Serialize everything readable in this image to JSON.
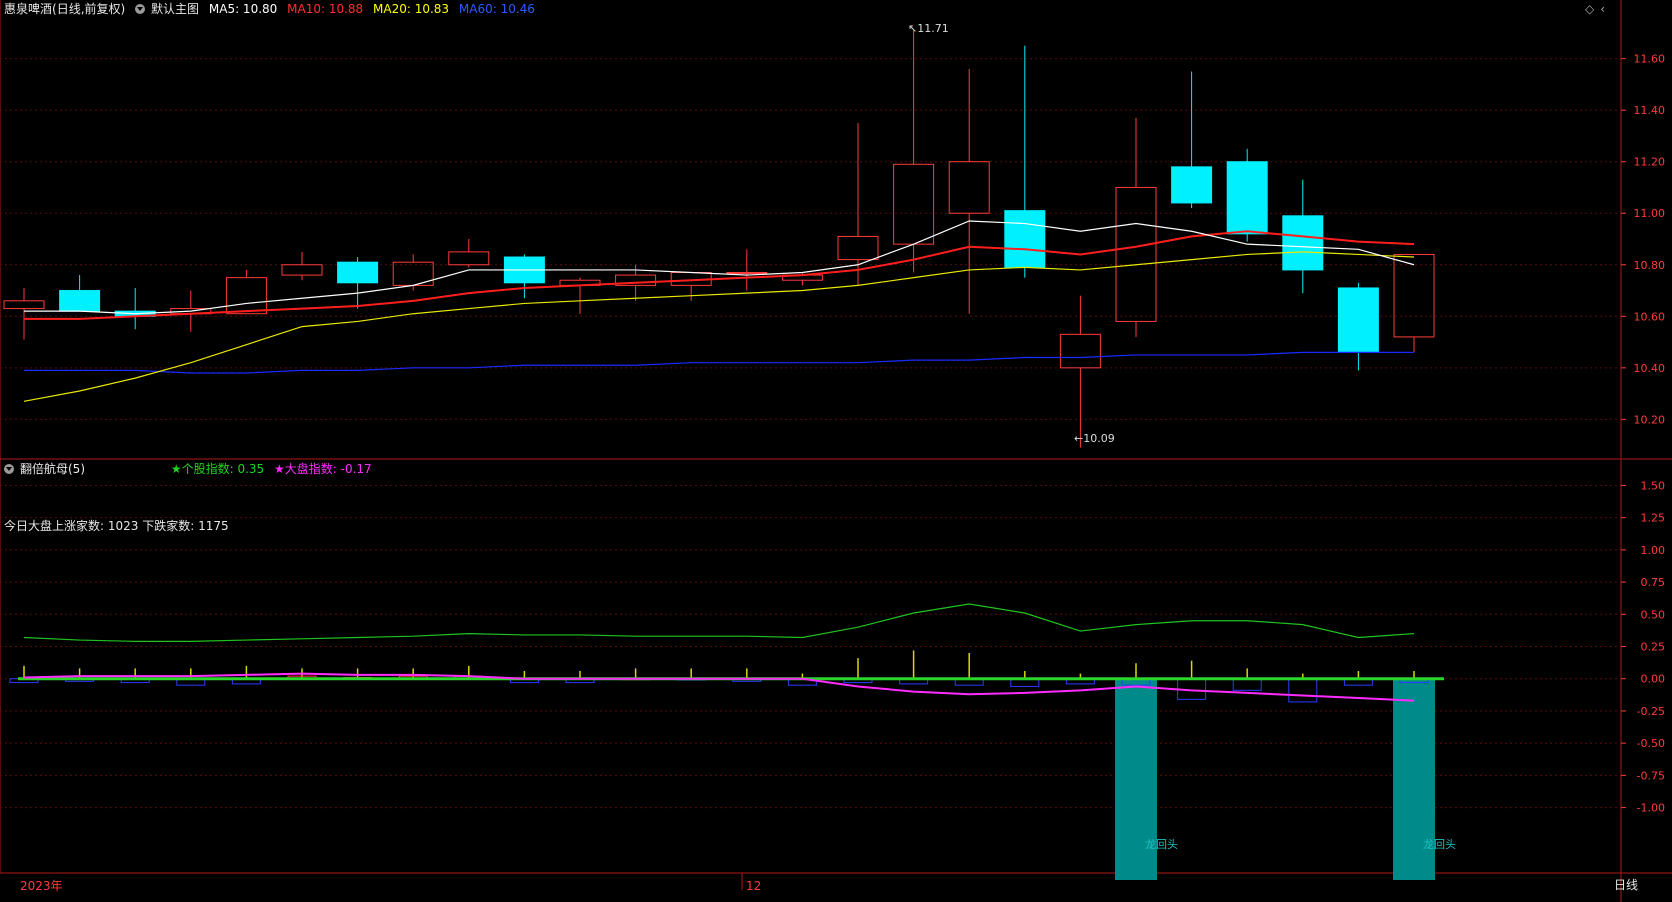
{
  "main_header": {
    "stock": "惠泉啤酒",
    "mode": "(日线,前复权)",
    "template": "默认主图",
    "ma": [
      {
        "label": "MA5: 10.80",
        "color": "#ffffff"
      },
      {
        "label": "MA10: 10.88",
        "color": "#ff3030"
      },
      {
        "label": "MA20: 10.83",
        "color": "#ffff00"
      },
      {
        "label": "MA60: 10.46",
        "color": "#2a5cff"
      }
    ]
  },
  "sub_header": {
    "indicator": "翻倍航母(5)",
    "stock_index": "★个股指数: 0.35",
    "market_index": "★大盘指数: -0.17",
    "breadth": "今日大盘上涨家数: 1023 下跌家数: 1175"
  },
  "annotations": {
    "high": "11.71",
    "low": "10.09",
    "signal_1": "龙回头",
    "signal_2": "龙回头"
  },
  "bottom_bar": {
    "year_label": "2023年",
    "month_label": "12",
    "period_tab": "日线"
  },
  "colors": {
    "up": "#ff3b3b",
    "down": "#00f0ff",
    "ma5": "#ffffff",
    "ma10": "#ff1e1e",
    "ma20": "#e8e800",
    "ma60": "#1a2bff",
    "stock_index_line": "#1fc41f",
    "market_index_line": "#ff2bff",
    "signal_bar": "#008b8b",
    "zero_line": "#2ad62a"
  },
  "chart_data": [
    {
      "type": "candlestick",
      "title": "惠泉啤酒 (日线,前复权)",
      "ylim": [
        10.05,
        11.75
      ],
      "yticks": [
        10.2,
        10.4,
        10.6,
        10.8,
        11.0,
        11.2,
        11.4,
        11.6
      ],
      "x": [
        0,
        1,
        2,
        3,
        4,
        5,
        6,
        7,
        8,
        9,
        10,
        11,
        12,
        13,
        14,
        15,
        16,
        17,
        18,
        19,
        20,
        21,
        22,
        23,
        24,
        25
      ],
      "ohlc": [
        [
          10.63,
          10.71,
          10.51,
          10.66
        ],
        [
          10.7,
          10.76,
          10.62,
          10.62
        ],
        [
          10.62,
          10.71,
          10.55,
          10.6
        ],
        [
          10.61,
          10.7,
          10.54,
          10.63
        ],
        [
          10.61,
          10.78,
          10.61,
          10.75
        ],
        [
          10.76,
          10.85,
          10.74,
          10.8
        ],
        [
          10.81,
          10.83,
          10.63,
          10.73
        ],
        [
          10.72,
          10.84,
          10.7,
          10.81
        ],
        [
          10.8,
          10.9,
          10.79,
          10.85
        ],
        [
          10.83,
          10.84,
          10.67,
          10.73
        ],
        [
          10.72,
          10.75,
          10.61,
          10.74
        ],
        [
          10.72,
          10.8,
          10.66,
          10.76
        ],
        [
          10.72,
          10.77,
          10.66,
          10.77
        ],
        [
          10.77,
          10.86,
          10.7,
          10.77
        ],
        [
          10.74,
          10.77,
          10.72,
          10.76
        ],
        [
          10.82,
          11.35,
          10.72,
          10.91
        ],
        [
          10.88,
          11.71,
          10.77,
          11.19
        ],
        [
          11.0,
          11.56,
          10.61,
          11.2
        ],
        [
          11.01,
          11.65,
          10.75,
          10.79
        ],
        [
          10.4,
          10.68,
          10.09,
          10.53
        ],
        [
          10.58,
          11.37,
          10.52,
          11.1
        ],
        [
          11.18,
          11.55,
          11.02,
          11.04
        ],
        [
          11.2,
          11.25,
          10.89,
          10.92
        ],
        [
          10.99,
          11.13,
          10.69,
          10.78
        ],
        [
          10.71,
          10.73,
          10.39,
          10.46
        ],
        [
          10.52,
          10.84,
          10.46,
          10.84
        ]
      ],
      "ma5": [
        10.62,
        10.62,
        10.61,
        10.62,
        10.65,
        10.67,
        10.69,
        10.72,
        10.78,
        10.78,
        10.78,
        10.78,
        10.77,
        10.76,
        10.77,
        10.8,
        10.88,
        10.97,
        10.96,
        10.93,
        10.96,
        10.93,
        10.88,
        10.87,
        10.86,
        10.8
      ],
      "ma10": [
        10.59,
        10.59,
        10.6,
        10.61,
        10.62,
        10.63,
        10.64,
        10.66,
        10.69,
        10.71,
        10.72,
        10.73,
        10.74,
        10.75,
        10.76,
        10.78,
        10.82,
        10.87,
        10.86,
        10.84,
        10.87,
        10.91,
        10.93,
        10.91,
        10.89,
        10.88
      ],
      "ma20": [
        10.27,
        10.31,
        10.36,
        10.42,
        10.49,
        10.56,
        10.58,
        10.61,
        10.63,
        10.65,
        10.66,
        10.67,
        10.68,
        10.69,
        10.7,
        10.72,
        10.75,
        10.78,
        10.79,
        10.78,
        10.8,
        10.82,
        10.84,
        10.85,
        10.84,
        10.83
      ],
      "ma60": [
        10.39,
        10.39,
        10.39,
        10.38,
        10.38,
        10.39,
        10.39,
        10.4,
        10.4,
        10.41,
        10.41,
        10.41,
        10.42,
        10.42,
        10.42,
        10.42,
        10.43,
        10.43,
        10.44,
        10.44,
        10.45,
        10.45,
        10.45,
        10.46,
        10.46,
        10.46
      ],
      "axis_color": "#ff3b3b"
    },
    {
      "type": "line",
      "title": "翻倍航母(5)",
      "ylim": [
        -1.5,
        1.62
      ],
      "yticks": [
        -1.0,
        -0.75,
        -0.5,
        -0.25,
        0.0,
        0.25,
        0.5,
        0.75,
        1.0,
        1.25,
        1.5
      ],
      "x": [
        0,
        1,
        2,
        3,
        4,
        5,
        6,
        7,
        8,
        9,
        10,
        11,
        12,
        13,
        14,
        15,
        16,
        17,
        18,
        19,
        20,
        21,
        22,
        23,
        24,
        25
      ],
      "series": [
        {
          "name": "★个股指数",
          "values": [
            0.32,
            0.3,
            0.29,
            0.29,
            0.3,
            0.31,
            0.32,
            0.33,
            0.35,
            0.34,
            0.34,
            0.33,
            0.33,
            0.33,
            0.32,
            0.4,
            0.51,
            0.58,
            0.51,
            0.37,
            0.42,
            0.45,
            0.45,
            0.42,
            0.32,
            0.35
          ]
        },
        {
          "name": "★大盘指数",
          "values": [
            0.01,
            0.02,
            0.02,
            0.02,
            0.03,
            0.04,
            0.03,
            0.03,
            0.02,
            0.0,
            0.0,
            0.0,
            0.0,
            0.0,
            0.0,
            -0.06,
            -0.1,
            -0.12,
            -0.11,
            -0.09,
            -0.06,
            -0.09,
            -0.11,
            -0.13,
            -0.15,
            -0.17
          ]
        }
      ],
      "stock_bars": [
        0.1,
        0.08,
        0.08,
        0.08,
        0.1,
        0.08,
        0.08,
        0.08,
        0.1,
        0.06,
        0.06,
        0.08,
        0.08,
        0.08,
        0.04,
        0.16,
        0.22,
        0.2,
        0.06,
        0.04,
        0.12,
        0.14,
        0.08,
        0.04,
        0.06,
        0.06
      ],
      "market_bars": [
        -0.03,
        -0.02,
        -0.03,
        -0.05,
        -0.04,
        0.02,
        0.01,
        0.02,
        0.02,
        -0.03,
        -0.03,
        0.0,
        -0.01,
        -0.02,
        -0.05,
        -0.03,
        -0.04,
        -0.05,
        -0.06,
        -0.04,
        -0.05,
        -0.16,
        -0.09,
        -0.18,
        -0.05,
        -0.03
      ],
      "signal_bars": [
        {
          "x": 20,
          "label": "龙回头"
        },
        {
          "x": 25,
          "label": "龙回头"
        }
      ]
    }
  ]
}
